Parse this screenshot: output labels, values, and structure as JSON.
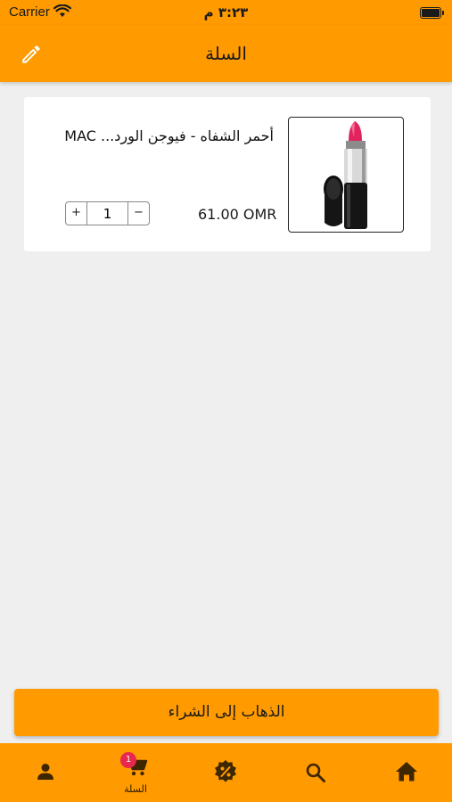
{
  "status_bar": {
    "carrier": "Carrier",
    "time": "٣:٢٣ م"
  },
  "header": {
    "title": "السلة"
  },
  "cart": {
    "items": [
      {
        "name": "أحمر الشفاه - فيوجن الورد... MAC",
        "price": "61.00  OMR",
        "quantity": "1",
        "plus_label": "+",
        "minus_label": "−"
      }
    ]
  },
  "checkout": {
    "label": "الذهاب إلى الشراء"
  },
  "tab_bar": {
    "cart_label": "السلة",
    "cart_badge": "1",
    "icons": [
      "user-icon",
      "cart-icon",
      "offers-icon",
      "search-icon",
      "home-icon"
    ]
  },
  "colors": {
    "accent": "#ff9a00",
    "background": "#efefef",
    "badge": "#e8264e"
  }
}
